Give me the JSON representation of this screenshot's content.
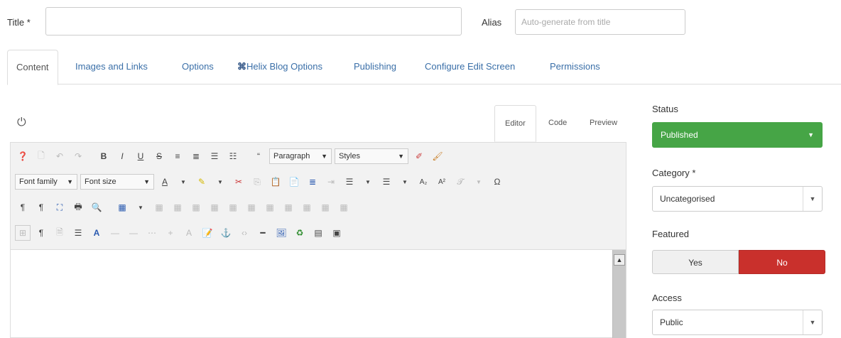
{
  "title_field": {
    "label": "Title *",
    "value": ""
  },
  "alias_field": {
    "label": "Alias",
    "placeholder": "Auto-generate from title"
  },
  "tabs": [
    {
      "label": "Content"
    },
    {
      "label": "Images and Links"
    },
    {
      "label": "Options"
    },
    {
      "label": "Helix Blog Options"
    },
    {
      "label": "Publishing"
    },
    {
      "label": "Configure Edit Screen"
    },
    {
      "label": "Permissions"
    }
  ],
  "editor": {
    "tabs": [
      {
        "label": "Editor"
      },
      {
        "label": "Code"
      },
      {
        "label": "Preview"
      }
    ],
    "paragraph_select": "Paragraph",
    "styles_select": "Styles",
    "font_family_select": "Font family",
    "font_size_select": "Font size"
  },
  "sidebar": {
    "status": {
      "label": "Status",
      "value": "Published"
    },
    "category": {
      "label": "Category *",
      "value": "Uncategorised"
    },
    "featured": {
      "label": "Featured",
      "yes": "Yes",
      "no": "No",
      "selected": "No"
    },
    "access": {
      "label": "Access",
      "value": "Public"
    }
  },
  "colors": {
    "published": "#46a546",
    "no_active": "#c9302c",
    "link": "#3a6fa8"
  }
}
